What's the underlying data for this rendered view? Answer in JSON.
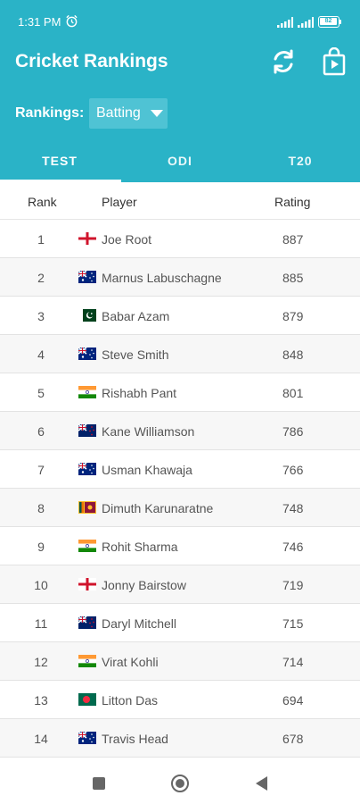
{
  "status_bar": {
    "time": "1:31 PM",
    "battery": "82"
  },
  "app": {
    "title": "Cricket Rankings"
  },
  "filter": {
    "label": "Rankings:",
    "selected": "Batting"
  },
  "tabs": [
    {
      "label": "TEST",
      "active": true
    },
    {
      "label": "ODI",
      "active": false
    },
    {
      "label": "T20",
      "active": false
    }
  ],
  "table": {
    "headers": {
      "rank": "Rank",
      "player": "Player",
      "rating": "Rating"
    },
    "rows": [
      {
        "rank": "1",
        "player": "Joe Root",
        "rating": "887",
        "flag": "england-flag-icon"
      },
      {
        "rank": "2",
        "player": "Marnus Labuschagne",
        "rating": "885",
        "flag": "australia-flag-icon"
      },
      {
        "rank": "3",
        "player": "Babar Azam",
        "rating": "879",
        "flag": "pakistan-flag-icon"
      },
      {
        "rank": "4",
        "player": "Steve Smith",
        "rating": "848",
        "flag": "australia-flag-icon"
      },
      {
        "rank": "5",
        "player": "Rishabh Pant",
        "rating": "801",
        "flag": "india-flag-icon"
      },
      {
        "rank": "6",
        "player": "Kane Williamson",
        "rating": "786",
        "flag": "new-zealand-flag-icon"
      },
      {
        "rank": "7",
        "player": "Usman Khawaja",
        "rating": "766",
        "flag": "australia-flag-icon"
      },
      {
        "rank": "8",
        "player": "Dimuth Karunaratne",
        "rating": "748",
        "flag": "sri-lanka-flag-icon"
      },
      {
        "rank": "9",
        "player": "Rohit Sharma",
        "rating": "746",
        "flag": "india-flag-icon"
      },
      {
        "rank": "10",
        "player": "Jonny Bairstow",
        "rating": "719",
        "flag": "england-flag-icon"
      },
      {
        "rank": "11",
        "player": "Daryl Mitchell",
        "rating": "715",
        "flag": "new-zealand-flag-icon"
      },
      {
        "rank": "12",
        "player": "Virat Kohli",
        "rating": "714",
        "flag": "india-flag-icon"
      },
      {
        "rank": "13",
        "player": "Litton Das",
        "rating": "694",
        "flag": "bangladesh-flag-icon"
      },
      {
        "rank": "14",
        "player": "Travis Head",
        "rating": "678",
        "flag": "australia-flag-icon"
      }
    ]
  },
  "colors": {
    "primary": "#2ab3c7",
    "select_bg": "#4fc3d4",
    "row_alt": "#f7f7f7"
  },
  "icons": {
    "refresh": "refresh-icon",
    "store": "play-store-icon",
    "alarm": "alarm-icon",
    "dropdown": "dropdown-caret-icon"
  }
}
